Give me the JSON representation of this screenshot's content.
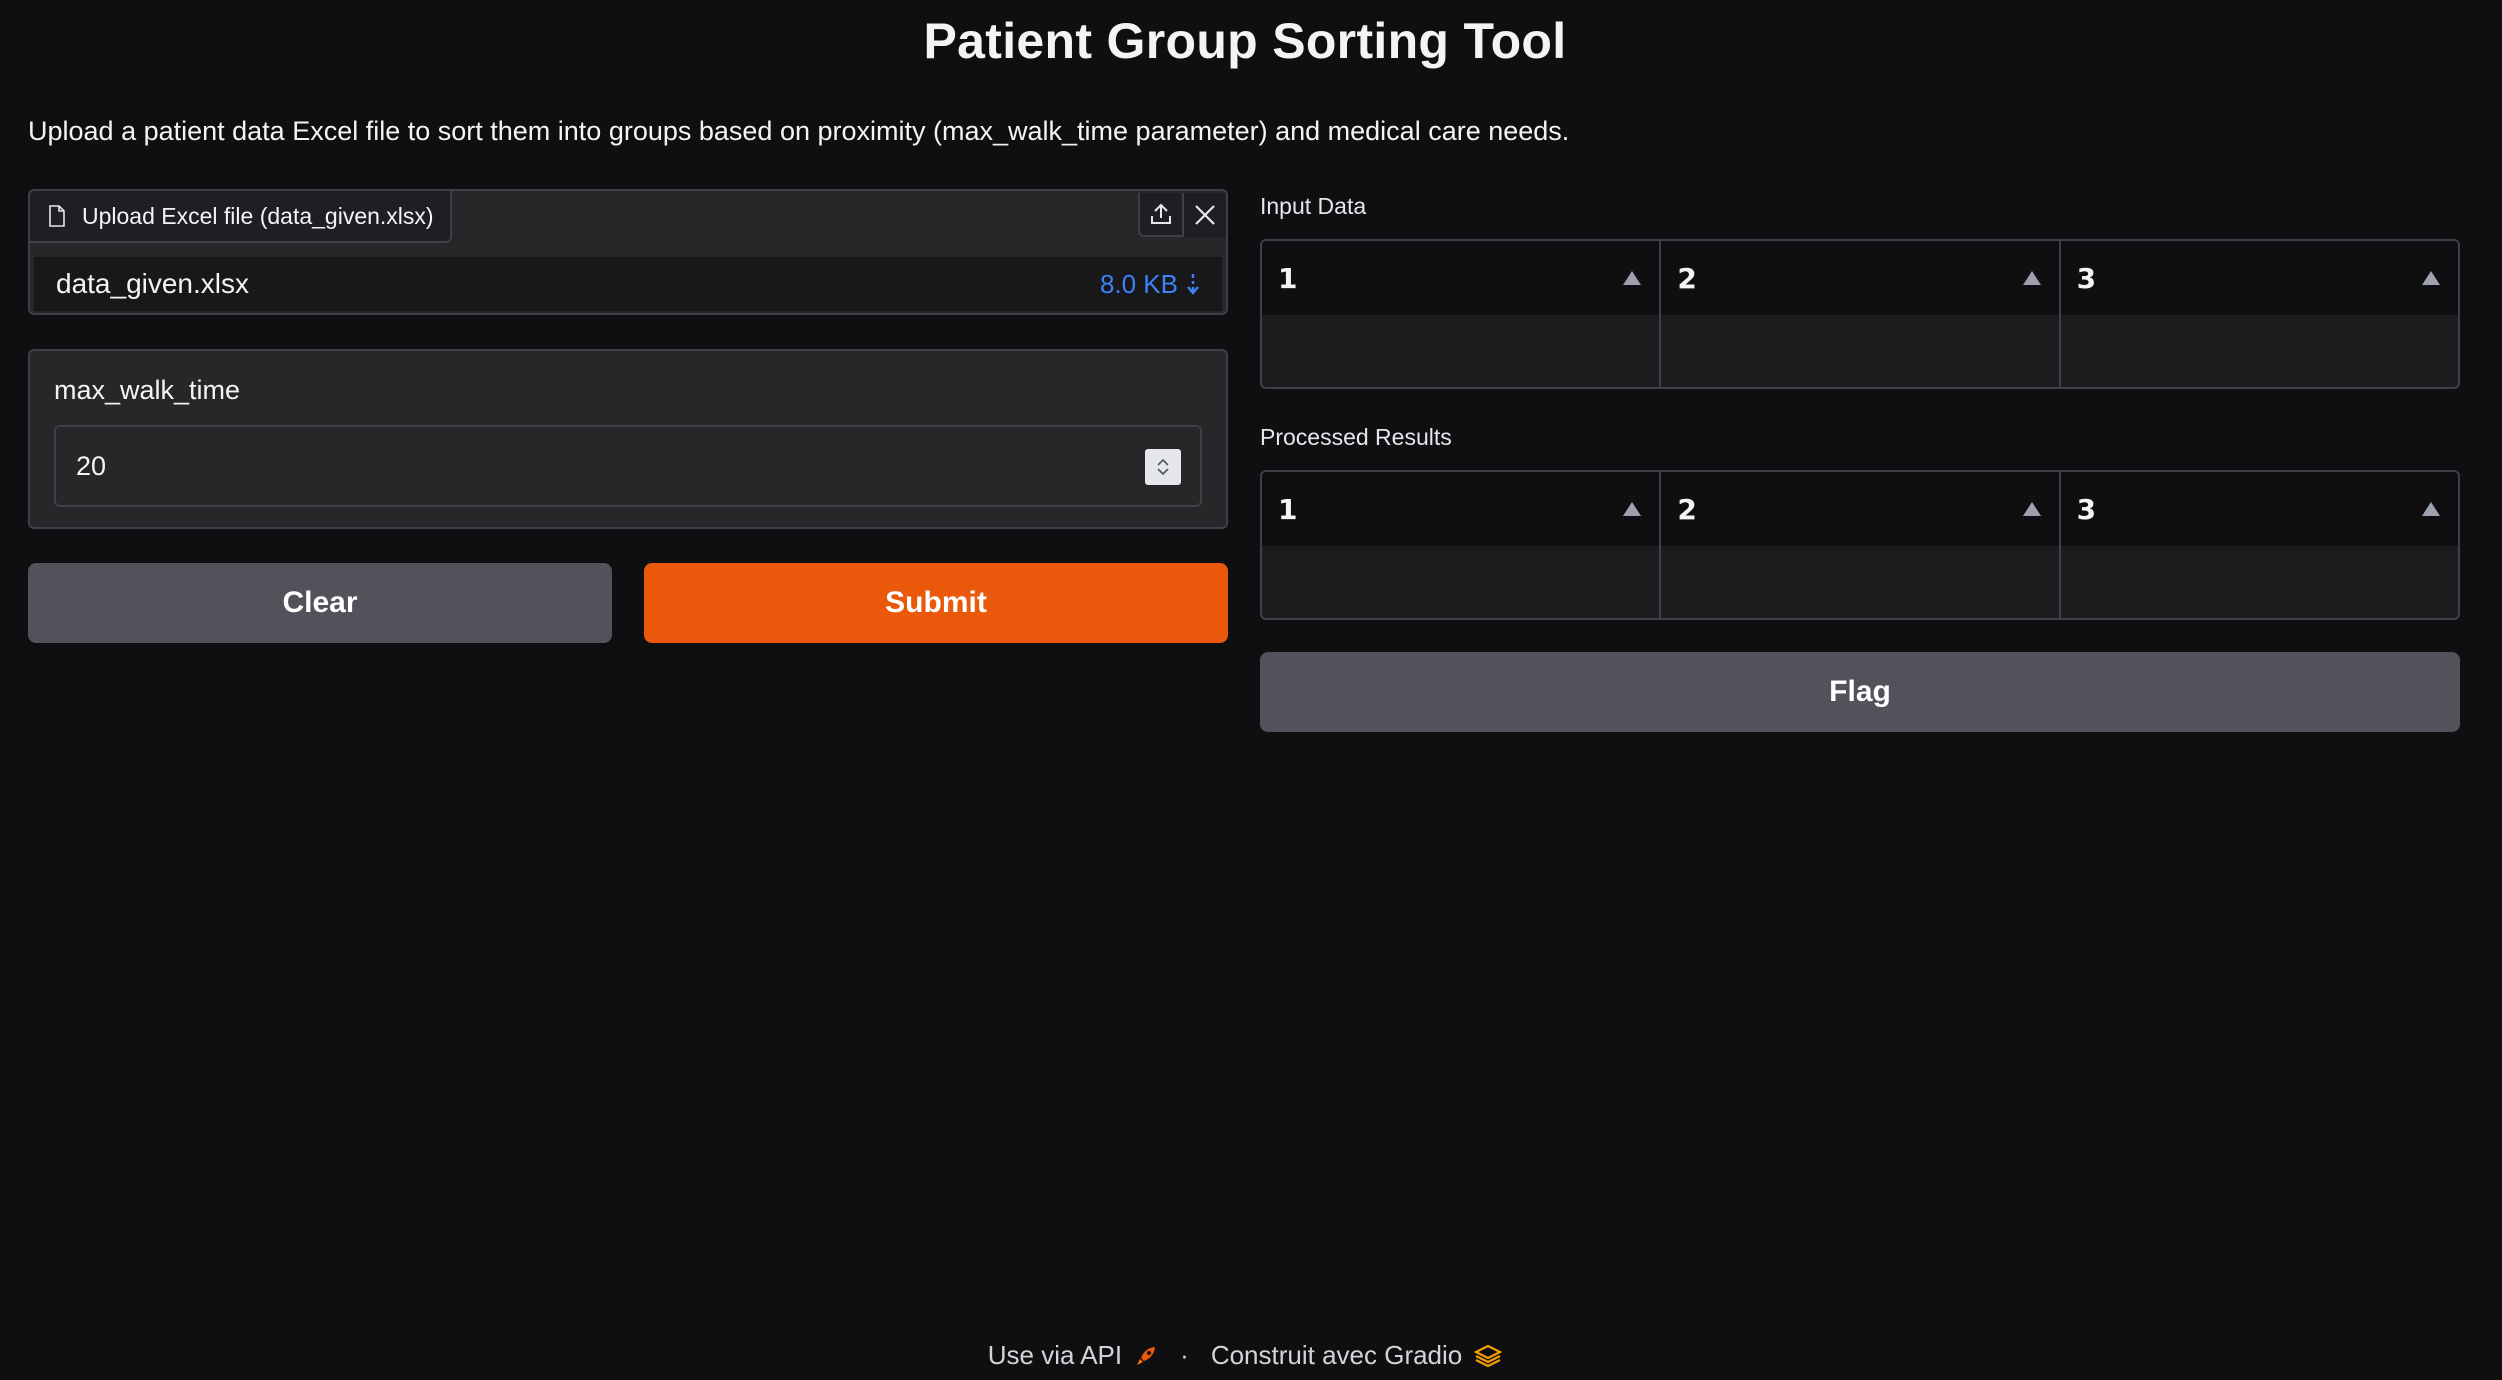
{
  "header": {
    "title": "Patient Group Sorting Tool",
    "description": "Upload a patient data Excel file to sort them into groups based on proximity (max_walk_time parameter) and medical care needs."
  },
  "file_upload": {
    "label": "Upload Excel file (data_given.xlsx)",
    "file_name": "data_given.xlsx",
    "file_size": "8.0 KB"
  },
  "walk_time": {
    "label": "max_walk_time",
    "value": "20"
  },
  "buttons": {
    "clear": "Clear",
    "submit": "Submit",
    "flag": "Flag"
  },
  "input_data": {
    "label": "Input Data",
    "columns": [
      "1",
      "2",
      "3"
    ]
  },
  "processed_results": {
    "label": "Processed Results",
    "columns": [
      "1",
      "2",
      "3"
    ]
  },
  "footer": {
    "api_link": "Use via API",
    "separator": "·",
    "built_with": "Construit avec Gradio"
  },
  "colors": {
    "background": "#0f0f11",
    "accent": "#ea580c",
    "link": "#3b82f6",
    "secondary_button": "#52525b"
  }
}
